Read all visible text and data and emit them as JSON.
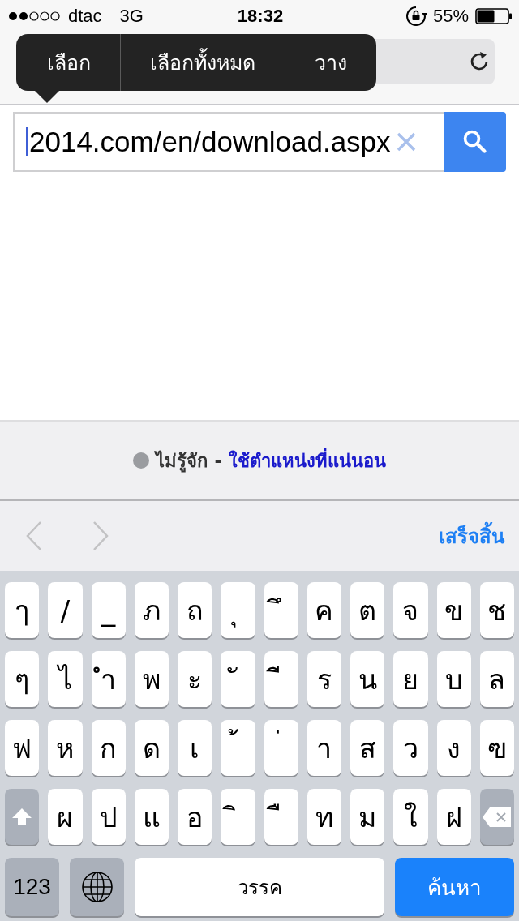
{
  "status_bar": {
    "carrier": "dtac",
    "network": "3G",
    "time": "18:32",
    "battery": "55%"
  },
  "edit_menu": {
    "items": [
      {
        "label": "เลือก"
      },
      {
        "label": "เลือกทั้งหมด"
      },
      {
        "label": "วาง"
      }
    ]
  },
  "address_field": {
    "value": "2014.com/en/download.aspx"
  },
  "location_panel": {
    "status": "ไม่รู้จัก",
    "separator": "-",
    "link": "ใช้ตำแหน่งที่แน่นอน"
  },
  "form_toolbar": {
    "done": "เสร็จสิ้น"
  },
  "keyboard": {
    "rows": [
      [
        {
          "kind": "letter",
          "label": "ๅ"
        },
        {
          "kind": "letter",
          "label": "/"
        },
        {
          "kind": "letter",
          "label": "_"
        },
        {
          "kind": "letter",
          "label": "ภ"
        },
        {
          "kind": "letter",
          "label": "ถ"
        },
        {
          "kind": "letter",
          "label": "ุ"
        },
        {
          "kind": "letter",
          "label": "ึ"
        },
        {
          "kind": "letter",
          "label": "ค"
        },
        {
          "kind": "letter",
          "label": "ต"
        },
        {
          "kind": "letter",
          "label": "จ"
        },
        {
          "kind": "letter",
          "label": "ข"
        },
        {
          "kind": "letter",
          "label": "ช"
        }
      ],
      [
        {
          "kind": "letter",
          "label": "ๆ"
        },
        {
          "kind": "letter",
          "label": "ไ"
        },
        {
          "kind": "letter",
          "label": "ำ"
        },
        {
          "kind": "letter",
          "label": "พ"
        },
        {
          "kind": "letter",
          "label": "ะ"
        },
        {
          "kind": "letter",
          "label": "ั"
        },
        {
          "kind": "letter",
          "label": "ี"
        },
        {
          "kind": "letter",
          "label": "ร"
        },
        {
          "kind": "letter",
          "label": "น"
        },
        {
          "kind": "letter",
          "label": "ย"
        },
        {
          "kind": "letter",
          "label": "บ"
        },
        {
          "kind": "letter",
          "label": "ล"
        }
      ],
      [
        {
          "kind": "letter",
          "label": "ฟ"
        },
        {
          "kind": "letter",
          "label": "ห"
        },
        {
          "kind": "letter",
          "label": "ก"
        },
        {
          "kind": "letter",
          "label": "ด"
        },
        {
          "kind": "letter",
          "label": "เ"
        },
        {
          "kind": "letter",
          "label": "้"
        },
        {
          "kind": "letter",
          "label": "่"
        },
        {
          "kind": "letter",
          "label": "า"
        },
        {
          "kind": "letter",
          "label": "ส"
        },
        {
          "kind": "letter",
          "label": "ว"
        },
        {
          "kind": "letter",
          "label": "ง"
        },
        {
          "kind": "letter",
          "label": "ฃ"
        }
      ],
      [
        {
          "kind": "shift"
        },
        {
          "kind": "letter",
          "label": "ผ"
        },
        {
          "kind": "letter",
          "label": "ป"
        },
        {
          "kind": "letter",
          "label": "แ"
        },
        {
          "kind": "letter",
          "label": "อ"
        },
        {
          "kind": "letter",
          "label": "ิ"
        },
        {
          "kind": "letter",
          "label": "ื"
        },
        {
          "kind": "letter",
          "label": "ท"
        },
        {
          "kind": "letter",
          "label": "ม"
        },
        {
          "kind": "letter",
          "label": "ใ"
        },
        {
          "kind": "letter",
          "label": "ฝ"
        },
        {
          "kind": "delete"
        }
      ]
    ],
    "numbers_key": "123",
    "space_key": "วรรค",
    "return_key": "ค้นหา"
  }
}
